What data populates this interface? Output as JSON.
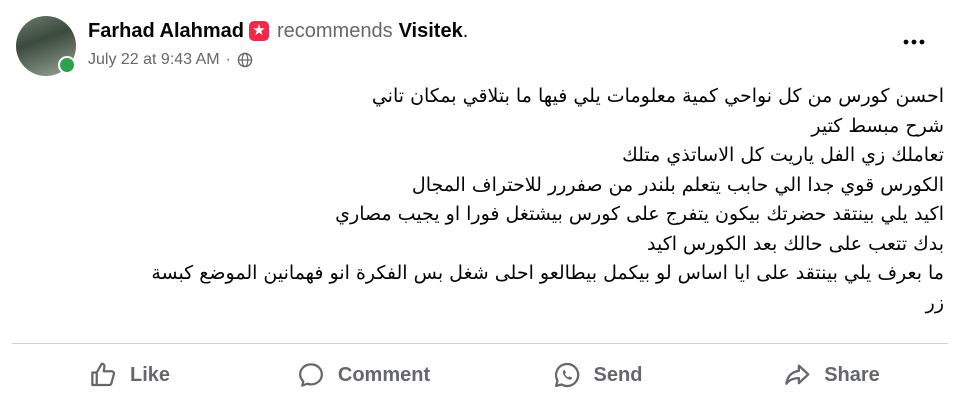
{
  "post": {
    "author": "Farhad Alahmad",
    "badge_icon": "recommend-badge-icon",
    "verb": "recommends",
    "page_name": "Visitek",
    "period": ".",
    "date": "July 22 at 9:43 AM",
    "separator": "·",
    "privacy_icon": "globe-icon",
    "body_lines": [
      "احسن كورس من كل نواحي كمية معلومات يلي فيها ما بتلاقي بمكان تاني",
      "شرح مبسط كتير",
      "تعاملك زي الفل ياريت كل الاساتذي متلك",
      "الكورس قوي جدا الي حابب يتعلم بلندر من صفررر للاحتراف المجال",
      "اكيد يلي بينتقد حضرتك بيكون يتفرج على كورس بيشتغل فورا او يجيب مصاري",
      "بدك تتعب على حالك بعد الكورس اكيد",
      "ما بعرف يلي بينتقد على ايا اساس لو بيكمل بيطالعو احلى شغل بس الفكرة انو فهمانين الموضع كبسة",
      "زر"
    ]
  },
  "actions": {
    "like": "Like",
    "comment": "Comment",
    "send": "Send",
    "share": "Share"
  },
  "colors": {
    "secondary_text": "#65676b",
    "primary_text": "#050505",
    "online": "#31a24c",
    "badge": "#f02849",
    "divider": "#ced0d4"
  }
}
